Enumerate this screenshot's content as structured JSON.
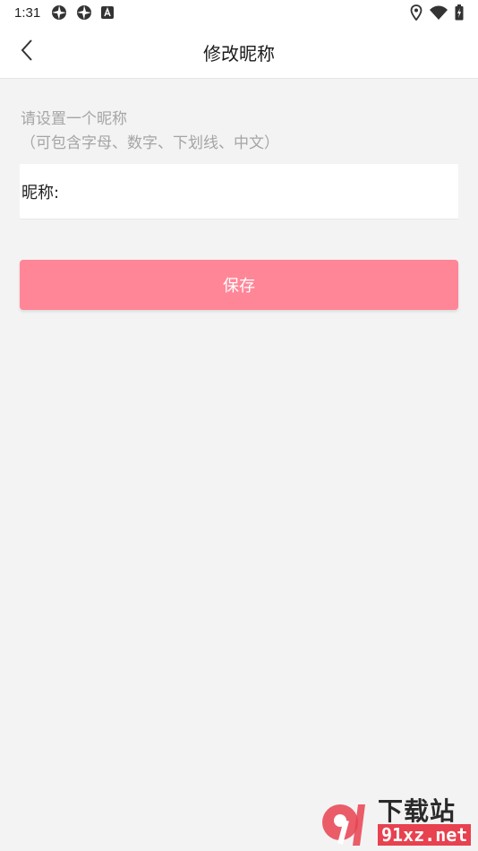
{
  "status_bar": {
    "time": "1:31",
    "left_icons": [
      "aperture-icon",
      "aperture-icon",
      "font-a-icon"
    ],
    "right_icons": [
      "location-icon",
      "wifi-icon",
      "battery-charging-icon"
    ]
  },
  "app_bar": {
    "title": "修改昵称",
    "back_icon": "chevron-left-icon"
  },
  "form": {
    "hint_line1": "请设置一个昵称",
    "hint_line2": "（可包含字母、数字、下划线、中文）",
    "nickname_label": "昵称:",
    "nickname_value": "",
    "nickname_placeholder": "",
    "save_label": "保存"
  },
  "watermark": {
    "logo_text": "91",
    "top_text": "下载站",
    "bottom_text": "91xz.net"
  },
  "colors": {
    "accent": "#ff8697",
    "background": "#f3f3f3",
    "hint_text": "#a5a5a5",
    "watermark_red": "#e8414f"
  }
}
